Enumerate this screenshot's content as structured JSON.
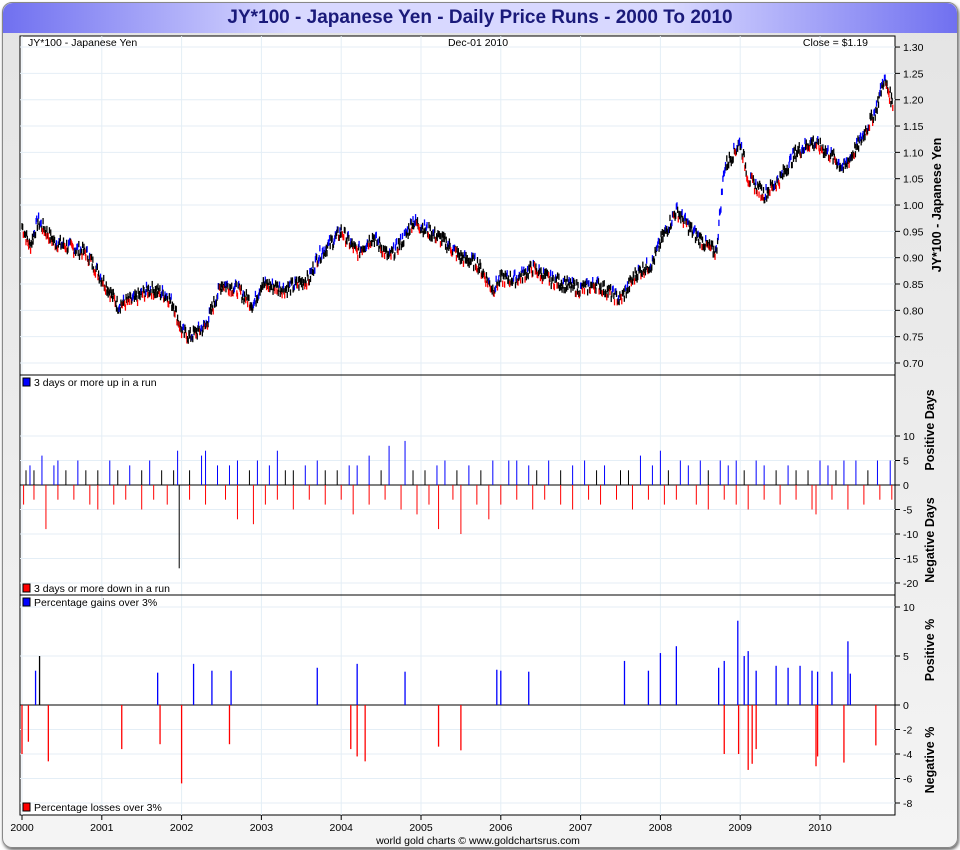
{
  "title": "JY*100  -  Japanese Yen - Daily Price Runs - 2000 To 2010",
  "header": {
    "left": "JY*100  -  Japanese Yen",
    "center": "Dec-01  2010",
    "right": "Close = $1.19"
  },
  "footer": "world gold charts © www.goldchartsrus.com",
  "colors": {
    "up": "#0000ff",
    "down": "#ff0000",
    "neutral": "#000000"
  },
  "chart_data": [
    {
      "type": "line",
      "title": "Japanese Yen daily price",
      "ylabel": "JY*100  -  Japanese Yen",
      "ylim": [
        0.7,
        1.3
      ],
      "yticks": [
        "1.30",
        "1.25",
        "1.20",
        "1.15",
        "1.10",
        "1.05",
        "1.00",
        "0.95",
        "0.90",
        "0.85",
        "0.80",
        "0.75",
        "0.70"
      ],
      "x": [
        2000.0,
        2000.1,
        2000.2,
        2000.4,
        2000.6,
        2000.8,
        2001.0,
        2001.2,
        2001.4,
        2001.6,
        2001.8,
        2001.9,
        2002.0,
        2002.1,
        2002.3,
        2002.5,
        2002.7,
        2002.9,
        2003.0,
        2003.3,
        2003.6,
        2003.7,
        2004.0,
        2004.2,
        2004.4,
        2004.6,
        2004.8,
        2004.9,
        2005.1,
        2005.3,
        2005.5,
        2005.7,
        2005.9,
        2006.0,
        2006.2,
        2006.4,
        2006.6,
        2006.8,
        2007.0,
        2007.2,
        2007.4,
        2007.5,
        2007.7,
        2007.9,
        2008.0,
        2008.2,
        2008.4,
        2008.6,
        2008.7,
        2008.8,
        2009.0,
        2009.1,
        2009.3,
        2009.5,
        2009.7,
        2009.9,
        2010.1,
        2010.3,
        2010.5,
        2010.7,
        2010.8,
        2010.92
      ],
      "y": [
        0.96,
        0.92,
        0.97,
        0.93,
        0.92,
        0.91,
        0.86,
        0.81,
        0.82,
        0.84,
        0.83,
        0.81,
        0.76,
        0.75,
        0.77,
        0.85,
        0.84,
        0.81,
        0.85,
        0.84,
        0.86,
        0.9,
        0.95,
        0.91,
        0.94,
        0.9,
        0.94,
        0.97,
        0.95,
        0.93,
        0.9,
        0.89,
        0.84,
        0.86,
        0.86,
        0.88,
        0.86,
        0.85,
        0.84,
        0.85,
        0.83,
        0.82,
        0.87,
        0.89,
        0.93,
        0.99,
        0.95,
        0.92,
        0.91,
        1.07,
        1.12,
        1.05,
        1.02,
        1.05,
        1.1,
        1.12,
        1.1,
        1.07,
        1.12,
        1.18,
        1.24,
        1.19
      ]
    },
    {
      "type": "bar",
      "title": "Price runs",
      "legend_up": "3 days or more up in a run",
      "legend_down": "3 days or more down in a run",
      "ylabel_up": "Positive Days",
      "ylabel_down": "Negative Days",
      "ylim": [
        -22,
        12
      ],
      "yticks": [
        "10",
        "5",
        "0",
        "-5",
        "-10",
        "-15",
        "-20"
      ],
      "up": [
        [
          2000.05,
          3
        ],
        [
          2000.1,
          4
        ],
        [
          2000.15,
          3
        ],
        [
          2000.25,
          6
        ],
        [
          2000.4,
          4
        ],
        [
          2000.45,
          5
        ],
        [
          2000.55,
          3
        ],
        [
          2000.7,
          5
        ],
        [
          2000.8,
          3
        ],
        [
          2000.95,
          3
        ],
        [
          2001.1,
          5
        ],
        [
          2001.2,
          3
        ],
        [
          2001.35,
          4
        ],
        [
          2001.5,
          3
        ],
        [
          2001.6,
          5
        ],
        [
          2001.75,
          3
        ],
        [
          2001.9,
          3
        ],
        [
          2001.95,
          7
        ],
        [
          2002.1,
          3
        ],
        [
          2002.25,
          6
        ],
        [
          2002.3,
          7
        ],
        [
          2002.45,
          4
        ],
        [
          2002.6,
          4
        ],
        [
          2002.7,
          5
        ],
        [
          2002.85,
          3
        ],
        [
          2002.95,
          5
        ],
        [
          2003.1,
          4
        ],
        [
          2003.2,
          7
        ],
        [
          2003.3,
          3
        ],
        [
          2003.4,
          3
        ],
        [
          2003.55,
          4
        ],
        [
          2003.7,
          5
        ],
        [
          2003.8,
          3
        ],
        [
          2003.95,
          3
        ],
        [
          2004.1,
          4
        ],
        [
          2004.2,
          4
        ],
        [
          2004.35,
          6
        ],
        [
          2004.5,
          3
        ],
        [
          2004.6,
          8
        ],
        [
          2004.8,
          9
        ],
        [
          2004.9,
          3
        ],
        [
          2005.05,
          3
        ],
        [
          2005.2,
          4
        ],
        [
          2005.3,
          5
        ],
        [
          2005.45,
          3
        ],
        [
          2005.6,
          4
        ],
        [
          2005.75,
          3
        ],
        [
          2005.9,
          5
        ],
        [
          2006.1,
          5
        ],
        [
          2006.2,
          5
        ],
        [
          2006.35,
          4
        ],
        [
          2006.45,
          3
        ],
        [
          2006.6,
          5
        ],
        [
          2006.75,
          3
        ],
        [
          2006.9,
          4
        ],
        [
          2007.05,
          5
        ],
        [
          2007.2,
          3
        ],
        [
          2007.3,
          4
        ],
        [
          2007.5,
          3
        ],
        [
          2007.6,
          3
        ],
        [
          2007.75,
          6
        ],
        [
          2007.9,
          4
        ],
        [
          2008.0,
          7
        ],
        [
          2008.1,
          3
        ],
        [
          2008.25,
          5
        ],
        [
          2008.35,
          4
        ],
        [
          2008.5,
          5
        ],
        [
          2008.6,
          3
        ],
        [
          2008.75,
          5
        ],
        [
          2008.85,
          4
        ],
        [
          2008.95,
          5
        ],
        [
          2009.05,
          3
        ],
        [
          2009.2,
          5
        ],
        [
          2009.3,
          4
        ],
        [
          2009.45,
          3
        ],
        [
          2009.6,
          4
        ],
        [
          2009.7,
          3
        ],
        [
          2009.85,
          3
        ],
        [
          2010.0,
          5
        ],
        [
          2010.1,
          4
        ],
        [
          2010.2,
          3
        ],
        [
          2010.3,
          5
        ],
        [
          2010.45,
          5
        ],
        [
          2010.6,
          3
        ],
        [
          2010.72,
          5
        ],
        [
          2010.88,
          5
        ]
      ],
      "down": [
        [
          2000.02,
          -4
        ],
        [
          2000.15,
          -3
        ],
        [
          2000.3,
          -9
        ],
        [
          2000.45,
          -3
        ],
        [
          2000.65,
          -3
        ],
        [
          2000.85,
          -4
        ],
        [
          2000.95,
          -5
        ],
        [
          2001.15,
          -4
        ],
        [
          2001.3,
          -3
        ],
        [
          2001.5,
          -5
        ],
        [
          2001.65,
          -3
        ],
        [
          2001.82,
          -4
        ],
        [
          2001.97,
          -17
        ],
        [
          2002.1,
          -3
        ],
        [
          2002.3,
          -4
        ],
        [
          2002.55,
          -3
        ],
        [
          2002.7,
          -7
        ],
        [
          2002.9,
          -8
        ],
        [
          2003.05,
          -4
        ],
        [
          2003.2,
          -3
        ],
        [
          2003.4,
          -5
        ],
        [
          2003.6,
          -3
        ],
        [
          2003.8,
          -4
        ],
        [
          2004.0,
          -3
        ],
        [
          2004.15,
          -6
        ],
        [
          2004.35,
          -4
        ],
        [
          2004.55,
          -3
        ],
        [
          2004.75,
          -5
        ],
        [
          2004.95,
          -6
        ],
        [
          2005.1,
          -4
        ],
        [
          2005.22,
          -9
        ],
        [
          2005.4,
          -3
        ],
        [
          2005.5,
          -10
        ],
        [
          2005.7,
          -4
        ],
        [
          2005.85,
          -7
        ],
        [
          2006.0,
          -4
        ],
        [
          2006.2,
          -3
        ],
        [
          2006.4,
          -5
        ],
        [
          2006.55,
          -3
        ],
        [
          2006.75,
          -4
        ],
        [
          2006.9,
          -5
        ],
        [
          2007.1,
          -3
        ],
        [
          2007.25,
          -4
        ],
        [
          2007.45,
          -3
        ],
        [
          2007.65,
          -5
        ],
        [
          2007.85,
          -3
        ],
        [
          2008.05,
          -4
        ],
        [
          2008.2,
          -3
        ],
        [
          2008.45,
          -4
        ],
        [
          2008.6,
          -5
        ],
        [
          2008.8,
          -3
        ],
        [
          2008.95,
          -4
        ],
        [
          2009.1,
          -5
        ],
        [
          2009.3,
          -3
        ],
        [
          2009.5,
          -4
        ],
        [
          2009.7,
          -3
        ],
        [
          2009.9,
          -5
        ],
        [
          2009.95,
          -6
        ],
        [
          2010.15,
          -3
        ],
        [
          2010.35,
          -5
        ],
        [
          2010.55,
          -4
        ],
        [
          2010.75,
          -3
        ],
        [
          2010.9,
          -3
        ]
      ]
    },
    {
      "type": "bar",
      "title": "Percentage moves",
      "legend_up": "Percentage gains over 3%",
      "legend_down": "Percentage losses over 3%",
      "ylabel_up": "Positive %",
      "ylabel_down": "Negative %",
      "yticks_up": [
        "10",
        "5",
        "0"
      ],
      "yticks_down": [
        "-2",
        "-4",
        "-6",
        "-8"
      ],
      "up": [
        [
          2000.17,
          3.5
        ],
        [
          2000.22,
          5
        ],
        [
          2001.7,
          3.3
        ],
        [
          2002.15,
          4.2
        ],
        [
          2002.38,
          3.5
        ],
        [
          2002.62,
          3.5
        ],
        [
          2003.7,
          3.8
        ],
        [
          2004.2,
          4.2
        ],
        [
          2004.8,
          3.4
        ],
        [
          2005.95,
          3.6
        ],
        [
          2006.0,
          3.5
        ],
        [
          2006.35,
          3.4
        ],
        [
          2007.55,
          4.5
        ],
        [
          2007.85,
          3.5
        ],
        [
          2008.0,
          5.3
        ],
        [
          2008.2,
          6
        ],
        [
          2008.73,
          3.8
        ],
        [
          2008.8,
          4.5
        ],
        [
          2008.97,
          8.6
        ],
        [
          2009.05,
          5
        ],
        [
          2009.1,
          5.5
        ],
        [
          2009.2,
          3.5
        ],
        [
          2009.45,
          4
        ],
        [
          2009.6,
          3.8
        ],
        [
          2009.75,
          4
        ],
        [
          2009.9,
          3.5
        ],
        [
          2009.97,
          3.4
        ],
        [
          2010.15,
          3.4
        ],
        [
          2010.35,
          6.5
        ],
        [
          2010.38,
          3.2
        ]
      ],
      "down": [
        [
          2000.0,
          -4
        ],
        [
          2000.08,
          -3
        ],
        [
          2000.33,
          -4.6
        ],
        [
          2001.25,
          -3.6
        ],
        [
          2001.73,
          -3.2
        ],
        [
          2002.0,
          -6.4
        ],
        [
          2002.6,
          -3.2
        ],
        [
          2004.12,
          -3.6
        ],
        [
          2004.2,
          -4.2
        ],
        [
          2004.3,
          -4.6
        ],
        [
          2005.22,
          -3.4
        ],
        [
          2005.5,
          -3.7
        ],
        [
          2008.8,
          -4
        ],
        [
          2008.98,
          -4
        ],
        [
          2009.1,
          -5.3
        ],
        [
          2009.15,
          -4.8
        ],
        [
          2009.2,
          -3.6
        ],
        [
          2009.95,
          -5
        ],
        [
          2009.97,
          -4.2
        ],
        [
          2010.3,
          -4.7
        ],
        [
          2010.7,
          -3.3
        ]
      ]
    }
  ],
  "xticks": [
    "2000",
    "2001",
    "2002",
    "2003",
    "2004",
    "2005",
    "2006",
    "2007",
    "2008",
    "2009",
    "2010"
  ]
}
